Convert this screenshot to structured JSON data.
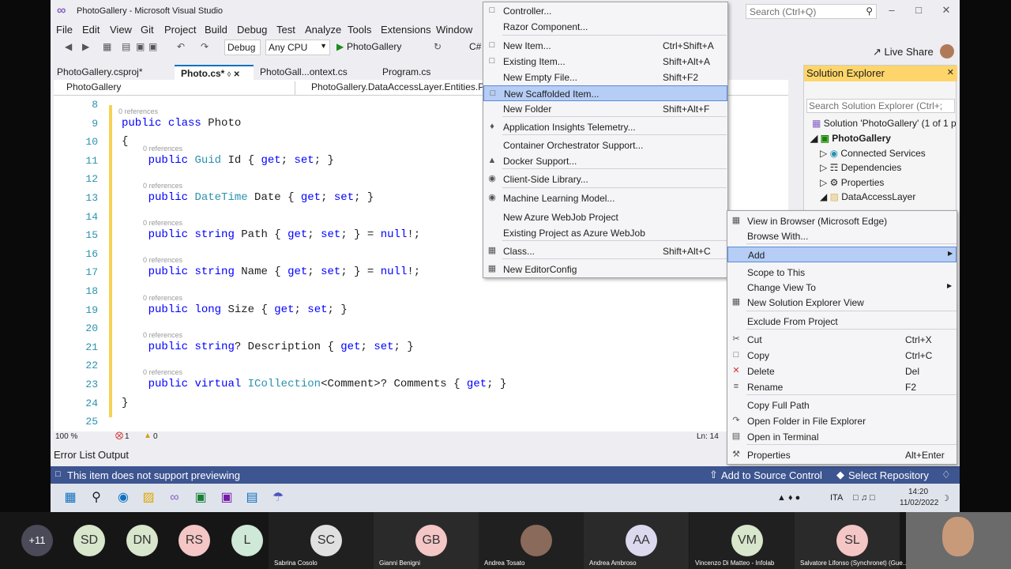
{
  "window": {
    "title": "PhotoGallery - Microsoft Visual Studio",
    "search_placeholder": "Search (Ctrl+Q)",
    "live_share": "Live Share"
  },
  "menu": [
    "File",
    "Edit",
    "View",
    "Git",
    "Project",
    "Build",
    "Debug",
    "Test",
    "Analyze",
    "Tools",
    "Extensions",
    "Window"
  ],
  "toolbar": {
    "config": "Debug",
    "platform": "Any CPU",
    "run_target": "PhotoGallery",
    "lang": "C#"
  },
  "tabs": [
    {
      "label": "PhotoGallery.csproj*",
      "active": false
    },
    {
      "label": "Photo.cs*",
      "active": true
    },
    {
      "label": "PhotoGall...ontext.cs",
      "active": false
    },
    {
      "label": "Program.cs",
      "active": false
    }
  ],
  "nav": {
    "project": "PhotoGallery",
    "class": "PhotoGallery.DataAccessLayer.Entities.Pho"
  },
  "code": {
    "refs": "0 references",
    "lines": [
      {
        "n": "8",
        "text": ""
      },
      {
        "n": "9",
        "text": "public class Photo"
      },
      {
        "n": "10",
        "text": "{"
      },
      {
        "n": "11",
        "text": "    public Guid Id { get; set; }"
      },
      {
        "n": "12",
        "text": ""
      },
      {
        "n": "13",
        "text": "    public DateTime Date { get; set; }"
      },
      {
        "n": "14",
        "text": ""
      },
      {
        "n": "15",
        "text": "    public string Path { get; set; } = null!;"
      },
      {
        "n": "16",
        "text": ""
      },
      {
        "n": "17",
        "text": "    public string Name { get; set; } = null!;"
      },
      {
        "n": "18",
        "text": ""
      },
      {
        "n": "19",
        "text": "    public long Size { get; set; }"
      },
      {
        "n": "20",
        "text": ""
      },
      {
        "n": "21",
        "text": "    public string? Description { get; set; }"
      },
      {
        "n": "22",
        "text": ""
      },
      {
        "n": "23",
        "text": "    public virtual ICollection<Comment>? Comments { get; }"
      },
      {
        "n": "24",
        "text": "}"
      },
      {
        "n": "25",
        "text": ""
      }
    ]
  },
  "editor_status": {
    "zoom": "100 %",
    "errors": "1",
    "warnings": "0",
    "line": "Ln: 14"
  },
  "bottom_tabs": {
    "error_list": "Error List",
    "output": "Output"
  },
  "status": {
    "message": "This item does not support previewing",
    "source_control": "Add to Source Control",
    "repo": "Select Repository"
  },
  "solution_explorer": {
    "title": "Solution Explorer",
    "search": "Search Solution Explorer (Ctrl+;",
    "items": [
      "Solution 'PhotoGallery' (1 of 1 p",
      "PhotoGallery",
      "Connected Services",
      "Dependencies",
      "Properties",
      "DataAccessLayer"
    ]
  },
  "add_submenu": [
    {
      "label": "Controller...",
      "shortcut": ""
    },
    {
      "label": "Razor Component...",
      "shortcut": ""
    },
    {
      "label": "New Item...",
      "shortcut": "Ctrl+Shift+A"
    },
    {
      "label": "Existing Item...",
      "shortcut": "Shift+Alt+A"
    },
    {
      "label": "New Empty File...",
      "shortcut": "Shift+F2"
    },
    {
      "label": "New Scaffolded Item...",
      "shortcut": ""
    },
    {
      "label": "New Folder",
      "shortcut": "Shift+Alt+F"
    },
    {
      "label": "Application Insights Telemetry...",
      "shortcut": ""
    },
    {
      "label": "Container Orchestrator Support...",
      "shortcut": ""
    },
    {
      "label": "Docker Support...",
      "shortcut": ""
    },
    {
      "label": "Client-Side Library...",
      "shortcut": ""
    },
    {
      "label": "Machine Learning Model...",
      "shortcut": ""
    },
    {
      "label": "New Azure WebJob Project",
      "shortcut": ""
    },
    {
      "label": "Existing Project as Azure WebJob",
      "shortcut": ""
    },
    {
      "label": "Class...",
      "shortcut": "Shift+Alt+C"
    },
    {
      "label": "New EditorConfig",
      "shortcut": ""
    }
  ],
  "context_menu": [
    {
      "label": "View in Browser (Microsoft Edge)",
      "shortcut": ""
    },
    {
      "label": "Browse With...",
      "shortcut": ""
    },
    {
      "label": "Add",
      "shortcut": ""
    },
    {
      "label": "Scope to This",
      "shortcut": ""
    },
    {
      "label": "Change View To",
      "shortcut": ""
    },
    {
      "label": "New Solution Explorer View",
      "shortcut": ""
    },
    {
      "label": "Exclude From Project",
      "shortcut": ""
    },
    {
      "label": "Cut",
      "shortcut": "Ctrl+X"
    },
    {
      "label": "Copy",
      "shortcut": "Ctrl+C"
    },
    {
      "label": "Delete",
      "shortcut": "Del"
    },
    {
      "label": "Rename",
      "shortcut": "F2"
    },
    {
      "label": "Copy Full Path",
      "shortcut": ""
    },
    {
      "label": "Open Folder in File Explorer",
      "shortcut": ""
    },
    {
      "label": "Open in Terminal",
      "shortcut": ""
    },
    {
      "label": "Properties",
      "shortcut": "Alt+Enter"
    }
  ],
  "tray": {
    "lang": "ITA",
    "time": "14:20",
    "date": "11/02/2022"
  },
  "meeting": {
    "more": "+11",
    "participants": [
      {
        "initials": "SD",
        "name": ""
      },
      {
        "initials": "DN",
        "name": ""
      },
      {
        "initials": "RS",
        "name": ""
      },
      {
        "initials": "L",
        "name": ""
      },
      {
        "initials": "SC",
        "name": "Sabrina Cosolo"
      },
      {
        "initials": "GB",
        "name": "Gianni Benigni"
      },
      {
        "initials": "",
        "name": "Andrea Tosato"
      },
      {
        "initials": "AA",
        "name": "Andrea Ambroso"
      },
      {
        "initials": "VM",
        "name": "Vincenzo Di Matteo - Infolab"
      },
      {
        "initials": "SL",
        "name": "Salvatore Lifonso (Synchronet) (Gue..."
      }
    ]
  }
}
